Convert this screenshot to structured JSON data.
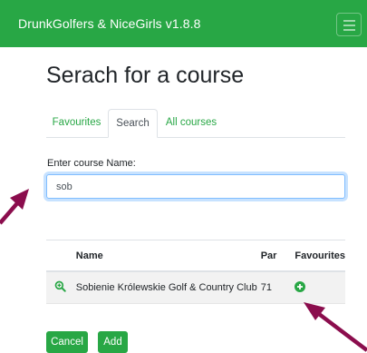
{
  "app": {
    "title": "DrunkGolfers & NiceGirls v1.8.8",
    "colors": {
      "brand": "#28a745",
      "annotation_arrow": "#8b0d4d"
    }
  },
  "page": {
    "title": "Serach for a course"
  },
  "tabs": [
    {
      "label": "Favourites",
      "active": false
    },
    {
      "label": "Search",
      "active": true
    },
    {
      "label": "All courses",
      "active": false
    }
  ],
  "search": {
    "label": "Enter course Name:",
    "value": "sob",
    "placeholder": ""
  },
  "results": {
    "columns": [
      "",
      "Name",
      "Par",
      "Favourites"
    ],
    "rows": [
      {
        "view_icon": "zoom-in-icon",
        "name": "Sobienie Królewskie Golf & Country Club",
        "par": "71",
        "fav_icon": "plus-circle-icon"
      }
    ]
  },
  "actions": {
    "cancel_label": "Cancel",
    "add_label": "Add"
  }
}
